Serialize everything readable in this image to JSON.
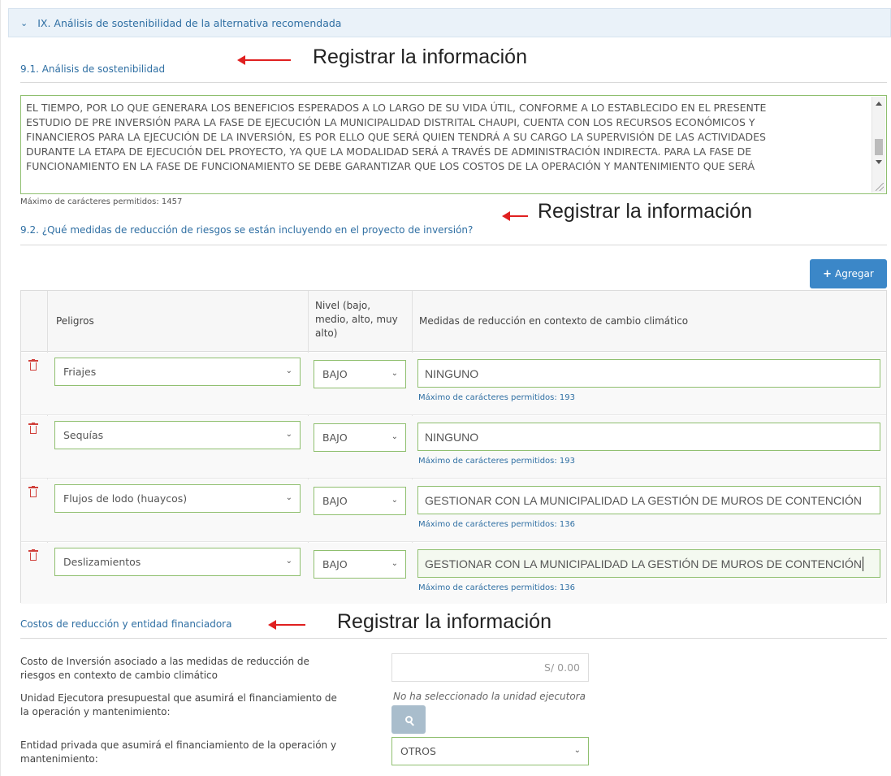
{
  "section": {
    "title": "IX. Análisis de sostenibilidad de la alternativa recomendada"
  },
  "sostenibilidad": {
    "subtitle": "9.1. Análisis de sostenibilidad",
    "text_lines": [
      "EL TIEMPO, POR LO QUE GENERARA LOS BENEFICIOS ESPERADOS A LO LARGO DE SU VIDA ÚTIL, CONFORME A LO ESTABLECIDO EN EL PRESENTE",
      "ESTUDIO DE PRE INVERSIÓN PARA LA FASE DE EJECUCIÓN LA MUNICIPALIDAD DISTRITAL CHAUPI, CUENTA CON LOS RECURSOS ECONÓMICOS Y",
      "FINANCIEROS PARA LA EJECUCIÓN DE LA INVERSIÓN, ES POR ELLO QUE SERÁ QUIEN TENDRÁ A SU CARGO LA SUPERVISIÓN DE LAS ACTIVIDADES",
      "DURANTE LA ETAPA DE EJECUCIÓN DEL PROYECTO, YA QUE LA MODALIDAD SERÁ A TRAVÉS DE ADMINISTRACIÓN INDIRECTA. PARA LA FASE DE",
      "FUNCIONAMIENTO EN LA FASE DE FUNCIONAMIENTO SE DEBE GARANTIZAR QUE LOS COSTOS DE LA OPERACIÓN Y MANTENIMIENTO QUE SERÁ"
    ],
    "max_chars": "Máximo de carácteres permitidos: 1457"
  },
  "annotations": {
    "a1": "Registrar la información",
    "a2": "Registrar la información",
    "a3": "Registrar la información"
  },
  "riesgos": {
    "subtitle": "9.2. ¿Qué medidas de reducción de riesgos se están incluyendo en el proyecto de inversión?",
    "add_button": "Agregar",
    "headers": {
      "peligros": "Peligros",
      "nivel_1": "Nivel (bajo,",
      "nivel_2": "medio, alto, muy",
      "nivel_3": "alto)",
      "medidas": "Medidas de reducción en contexto de cambio climático"
    },
    "rows": [
      {
        "peligro": "Friajes",
        "nivel": "BAJO",
        "medida": "NINGUNO",
        "max": "Máximo de carácteres permitidos: 193"
      },
      {
        "peligro": "Sequías",
        "nivel": "BAJO",
        "medida": "NINGUNO",
        "max": "Máximo de carácteres permitidos: 193"
      },
      {
        "peligro": "Flujos de lodo (huaycos)",
        "nivel": "BAJO",
        "medida": "GESTIONAR CON LA MUNICIPALIDAD LA GESTIÓN DE MUROS DE CONTENCIÓN",
        "max": "Máximo de carácteres permitidos: 136"
      },
      {
        "peligro": "Deslizamientos",
        "nivel": "BAJO",
        "medida": "GESTIONAR CON LA MUNICIPALIDAD LA GESTIÓN DE MUROS DE CONTENCIÓN",
        "max": "Máximo de carácteres permitidos: 136"
      }
    ]
  },
  "costos": {
    "subtitle": "Costos de reducción y entidad financiadora",
    "costo_label_1": "Costo de Inversión asociado a las medidas de reducción de",
    "costo_label_2": "riesgos en contexto de cambio climático",
    "costo_value": "S/  0.00",
    "unidad_label_1": "Unidad Ejecutora presupuestal que asumirá el financiamiento de",
    "unidad_label_2": "la operación y mantenimiento:",
    "unidad_value": "No ha seleccionado la unidad ejecutora",
    "privada_label_1": "Entidad privada que asumirá el financiamiento de la operación y",
    "privada_label_2": "mantenimiento:",
    "privada_value": "OTROS"
  },
  "colors": {
    "accent": "#2f6fa3",
    "button": "#3b87c8",
    "field_border": "#8fbf6f",
    "arrow": "#e02020",
    "delete": "#d0403b"
  }
}
